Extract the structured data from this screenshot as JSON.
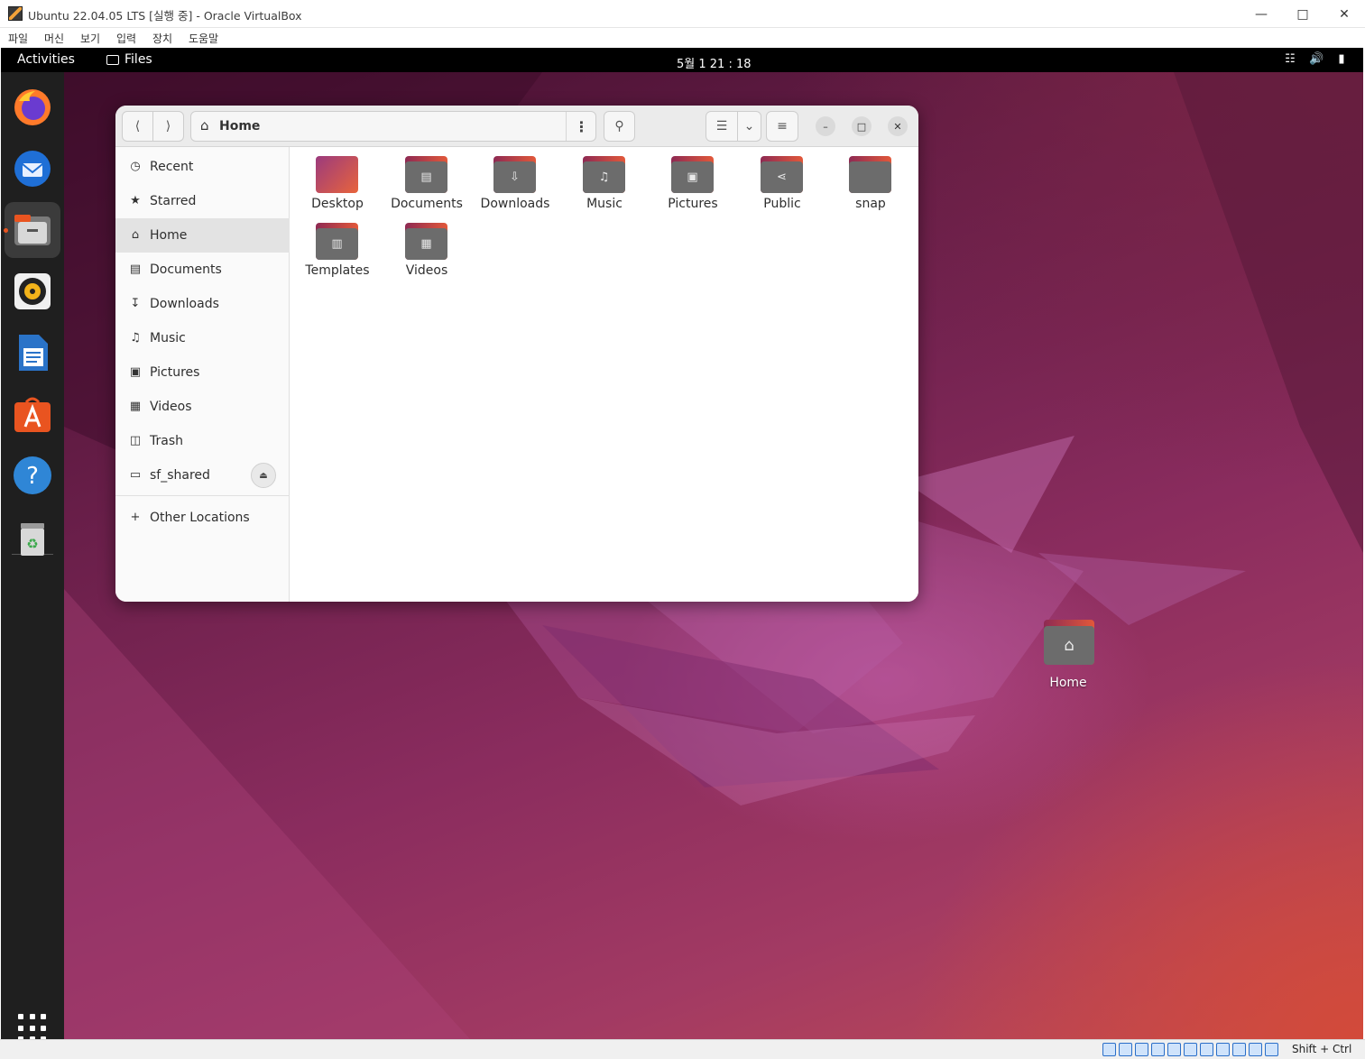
{
  "vbox": {
    "title": "Ubuntu 22.04.05 LTS [실행 중] - Oracle VirtualBox",
    "menu": [
      "파일",
      "머신",
      "보기",
      "입력",
      "장치",
      "도움말"
    ],
    "host_key": "Shift + Ctrl"
  },
  "topbar": {
    "activities": "Activities",
    "app_name": "Files",
    "clock": "5월 1  21 : 18"
  },
  "dock": {
    "items": [
      "firefox",
      "thunderbird",
      "files",
      "rhythmbox",
      "libreoffice-writer",
      "app-center",
      "help",
      "trash"
    ]
  },
  "files_window": {
    "path": "Home",
    "sidebar": [
      {
        "label": "Recent",
        "icon": "clock-icon"
      },
      {
        "label": "Starred",
        "icon": "star-icon"
      },
      {
        "label": "Home",
        "icon": "home-icon"
      },
      {
        "label": "Documents",
        "icon": "document-icon"
      },
      {
        "label": "Downloads",
        "icon": "download-icon"
      },
      {
        "label": "Music",
        "icon": "music-icon"
      },
      {
        "label": "Pictures",
        "icon": "picture-icon"
      },
      {
        "label": "Videos",
        "icon": "video-icon"
      },
      {
        "label": "Trash",
        "icon": "trash-icon"
      },
      {
        "label": "sf_shared",
        "icon": "drive-icon"
      }
    ],
    "other_locations": "Other Locations",
    "items": [
      {
        "label": "Desktop",
        "glyph": ""
      },
      {
        "label": "Documents",
        "glyph": "▤"
      },
      {
        "label": "Downloads",
        "glyph": "⇩"
      },
      {
        "label": "Music",
        "glyph": "♫"
      },
      {
        "label": "Pictures",
        "glyph": "▣"
      },
      {
        "label": "Public",
        "glyph": "⋖"
      },
      {
        "label": "snap",
        "glyph": ""
      },
      {
        "label": "Templates",
        "glyph": "▥"
      },
      {
        "label": "Videos",
        "glyph": "▦"
      }
    ]
  },
  "desktop": {
    "home_label": "Home"
  },
  "colors": {
    "accent": "#e95420",
    "dock_bg": "#1f1f1f",
    "topbar_bg": "#000000"
  }
}
